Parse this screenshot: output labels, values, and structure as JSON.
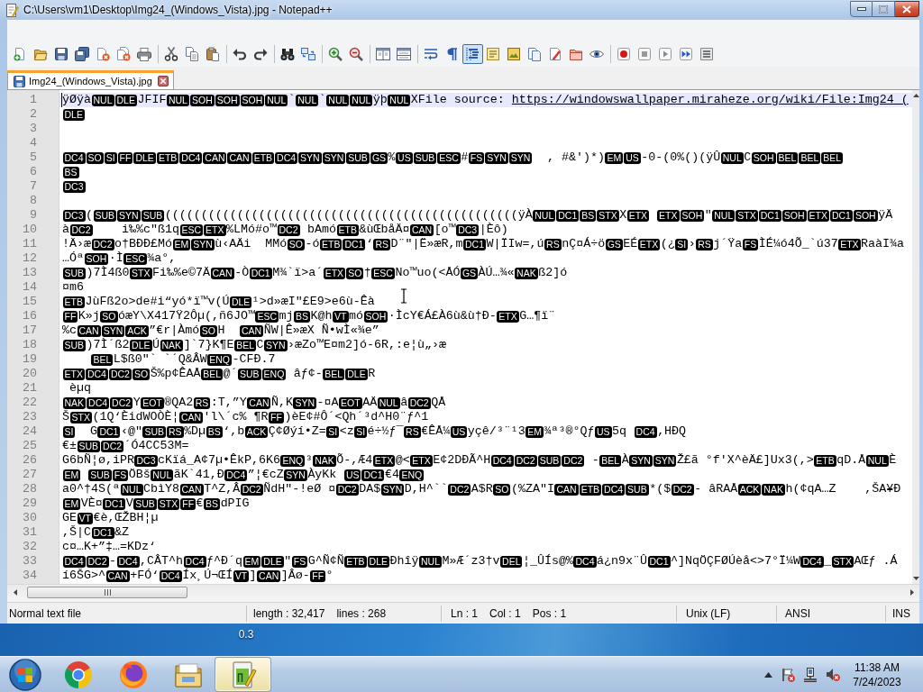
{
  "window": {
    "title": "C:\\Users\\vm1\\Desktop\\Img24_(Windows_Vista).jpg - Notepad++"
  },
  "toolbar": [
    [
      {
        "pressed": false
      },
      {
        "pressed": false
      },
      {
        "pressed": false
      },
      {
        "pressed": false
      },
      {
        "pressed": false
      },
      {
        "pressed": false
      },
      {
        "pressed": false
      }
    ],
    [
      {
        "pressed": false
      },
      {
        "pressed": false
      },
      {
        "pressed": false
      }
    ],
    [
      {
        "pressed": false
      },
      {
        "pressed": false
      }
    ],
    [
      {
        "pressed": false
      },
      {
        "pressed": false
      }
    ],
    [
      {
        "pressed": false
      },
      {
        "pressed": false
      }
    ],
    [
      {
        "pressed": false
      },
      {
        "pressed": false
      }
    ],
    [
      {
        "pressed": false
      },
      {
        "pressed": false
      },
      {
        "pressed": true
      },
      {
        "pressed": false
      },
      {
        "pressed": false
      },
      {
        "pressed": false
      },
      {
        "pressed": false
      },
      {
        "pressed": false
      },
      {
        "pressed": false
      }
    ],
    [
      {
        "pressed": false
      },
      {
        "pressed": false
      },
      {
        "pressed": false
      },
      {
        "pressed": false
      },
      {
        "pressed": false
      }
    ]
  ],
  "tabs": [
    {
      "label": "Img24_(Windows_Vista).jpg",
      "selected": true
    }
  ],
  "editor": {
    "lines": [
      {
        "number": "1",
        "current": true,
        "segments": [
          {
            "kind": "text",
            "text": "ÿØÿà"
          },
          {
            "kind": "control",
            "text": "NUL"
          },
          {
            "kind": "control",
            "text": "DLE"
          },
          {
            "kind": "text",
            "text": "JFIF"
          },
          {
            "kind": "control",
            "text": "NUL"
          },
          {
            "kind": "control",
            "text": "SOH"
          },
          {
            "kind": "control",
            "text": "SOH"
          },
          {
            "kind": "control",
            "text": "SOH"
          },
          {
            "kind": "control",
            "text": "NUL"
          },
          {
            "kind": "text",
            "text": "`"
          },
          {
            "kind": "control",
            "text": "NUL"
          },
          {
            "kind": "text",
            "text": "`"
          },
          {
            "kind": "control",
            "text": "NUL"
          },
          {
            "kind": "control",
            "text": "NUL"
          },
          {
            "kind": "text",
            "text": "ÿþ"
          },
          {
            "kind": "control",
            "text": "NUL"
          },
          {
            "kind": "text",
            "text": "XFile source: "
          },
          {
            "kind": "link",
            "text": "https://windowswallpaper.miraheze.org/wiki/File:Img24_("
          }
        ]
      },
      {
        "number": "2",
        "current": false,
        "segments": [
          {
            "kind": "control",
            "text": "DLE"
          }
        ]
      },
      {
        "number": "3",
        "current": false
      },
      {
        "number": "4",
        "current": false
      },
      {
        "number": "5",
        "current": false,
        "segments": [
          {
            "kind": "control",
            "text": "DC4"
          },
          {
            "kind": "control",
            "text": "SO"
          },
          {
            "kind": "control",
            "text": "SI"
          },
          {
            "kind": "control",
            "text": "FF"
          },
          {
            "kind": "control",
            "text": "DLE"
          },
          {
            "kind": "control",
            "text": "ETB"
          },
          {
            "kind": "control",
            "text": "DC4"
          },
          {
            "kind": "control",
            "text": "CAN"
          },
          {
            "kind": "control",
            "text": "CAN"
          },
          {
            "kind": "control",
            "text": "ETB"
          },
          {
            "kind": "control",
            "text": "DC4"
          },
          {
            "kind": "control",
            "text": "SYN"
          },
          {
            "kind": "control",
            "text": "SYN"
          },
          {
            "kind": "control",
            "text": "SUB"
          },
          {
            "kind": "control",
            "text": "GS"
          },
          {
            "kind": "text",
            "text": "%"
          },
          {
            "kind": "control",
            "text": "US"
          },
          {
            "kind": "control",
            "text": "SUB"
          },
          {
            "kind": "control",
            "text": "ESC"
          },
          {
            "kind": "text",
            "text": "#"
          },
          {
            "kind": "control",
            "text": "FS"
          },
          {
            "kind": "control",
            "text": "SYN"
          },
          {
            "kind": "control",
            "text": "SYN"
          },
          {
            "kind": "text",
            "text": "  , #&')*)"
          },
          {
            "kind": "control",
            "text": "EM"
          },
          {
            "kind": "control",
            "text": "US"
          },
          {
            "kind": "text",
            "text": "-0-(0%()(ÿÛ"
          },
          {
            "kind": "control",
            "text": "NUL"
          },
          {
            "kind": "text",
            "text": "C"
          },
          {
            "kind": "control",
            "text": "SOH"
          },
          {
            "kind": "control",
            "text": "BEL"
          },
          {
            "kind": "control",
            "text": "BEL"
          },
          {
            "kind": "control",
            "text": "BEL"
          }
        ]
      },
      {
        "number": "6",
        "current": false,
        "segments": [
          {
            "kind": "control",
            "text": "BS"
          }
        ]
      },
      {
        "number": "7",
        "current": false,
        "segments": [
          {
            "kind": "control",
            "text": "DC3"
          }
        ]
      },
      {
        "number": "8",
        "current": false
      },
      {
        "number": "9",
        "current": false,
        "segments": [
          {
            "kind": "control",
            "text": "DC3"
          },
          {
            "kind": "text",
            "text": "("
          },
          {
            "kind": "control",
            "text": "SUB"
          },
          {
            "kind": "control",
            "text": "SYN"
          },
          {
            "kind": "control",
            "text": "SUB"
          },
          {
            "kind": "text",
            "text": "(((((((((((((((((((((((((((((((((((((((((((((((((ÿÀ"
          },
          {
            "kind": "control",
            "text": "NUL"
          },
          {
            "kind": "control",
            "text": "DC1"
          },
          {
            "kind": "control",
            "text": "BS"
          },
          {
            "kind": "control",
            "text": "STX"
          },
          {
            "kind": "text",
            "text": "X"
          },
          {
            "kind": "control",
            "text": "ETX"
          },
          {
            "kind": "space"
          },
          {
            "kind": "control",
            "text": "ETX"
          },
          {
            "kind": "control",
            "text": "SOH"
          },
          {
            "kind": "text",
            "text": "\""
          },
          {
            "kind": "control",
            "text": "NUL"
          },
          {
            "kind": "control",
            "text": "STX"
          },
          {
            "kind": "control",
            "text": "DC1"
          },
          {
            "kind": "control",
            "text": "SOH"
          },
          {
            "kind": "control",
            "text": "ETX"
          },
          {
            "kind": "control",
            "text": "DC1"
          },
          {
            "kind": "control",
            "text": "SOH"
          },
          {
            "kind": "text",
            "text": "ÿÄ"
          }
        ]
      },
      {
        "number": "10",
        "current": false,
        "segments": [
          {
            "kind": "text",
            "text": "à"
          },
          {
            "kind": "control",
            "text": "DC2"
          },
          {
            "kind": "text",
            "text": "    i‰%c\"ß1q"
          },
          {
            "kind": "control",
            "text": "ESC"
          },
          {
            "kind": "control",
            "text": "ETX"
          },
          {
            "kind": "text",
            "text": "%LMó#o™"
          },
          {
            "kind": "control",
            "text": "DC2"
          },
          {
            "kind": "text",
            "text": " bAmó"
          },
          {
            "kind": "control",
            "text": "ETB"
          },
          {
            "kind": "text",
            "text": "&ùŒbåÄ¤"
          },
          {
            "kind": "control",
            "text": "CAN"
          },
          {
            "kind": "text",
            "text": "[o™"
          },
          {
            "kind": "control",
            "text": "DC3"
          },
          {
            "kind": "text",
            "text": "|Èô)"
          }
        ]
      },
      {
        "number": "11",
        "current": false,
        "segments": [
          {
            "kind": "text",
            "text": "!Ä›æ"
          },
          {
            "kind": "control",
            "text": "DC2"
          },
          {
            "kind": "text",
            "text": "o†BÐÐ£Mó"
          },
          {
            "kind": "control",
            "text": "EM"
          },
          {
            "kind": "control",
            "text": "SYN"
          },
          {
            "kind": "text",
            "text": "ù‹AÄi  MMó"
          },
          {
            "kind": "control",
            "text": "SO"
          },
          {
            "kind": "text",
            "text": "-ó"
          },
          {
            "kind": "control",
            "text": "ETB"
          },
          {
            "kind": "control",
            "text": "DC1"
          },
          {
            "kind": "text",
            "text": "‘"
          },
          {
            "kind": "control",
            "text": "RS"
          },
          {
            "kind": "text",
            "text": "D¨\"|Ë»æR,m"
          },
          {
            "kind": "control",
            "text": "DC1"
          },
          {
            "kind": "text",
            "text": "W|ÏIw=,ú"
          },
          {
            "kind": "control",
            "text": "RS"
          },
          {
            "kind": "text",
            "text": "nÇ¤Á÷ö"
          },
          {
            "kind": "control",
            "text": "GS"
          },
          {
            "kind": "text",
            "text": "EÉ"
          },
          {
            "kind": "control",
            "text": "ETX"
          },
          {
            "kind": "text",
            "text": "(¿"
          },
          {
            "kind": "control",
            "text": "SI"
          },
          {
            "kind": "text",
            "text": "›"
          },
          {
            "kind": "control",
            "text": "RS"
          },
          {
            "kind": "text",
            "text": "j´Ÿa"
          },
          {
            "kind": "control",
            "text": "FS"
          },
          {
            "kind": "text",
            "text": "ÌÉ¼ó4Õ_`ú37"
          },
          {
            "kind": "control",
            "text": "ETX"
          },
          {
            "kind": "text",
            "text": "RaàI¾a"
          }
        ]
      },
      {
        "number": "12",
        "current": false,
        "segments": [
          {
            "kind": "text",
            "text": "…Óª"
          },
          {
            "kind": "control",
            "text": "SOH"
          },
          {
            "kind": "text",
            "text": "·Ì"
          },
          {
            "kind": "control",
            "text": "ESC"
          },
          {
            "kind": "text",
            "text": "¾a°,"
          }
        ]
      },
      {
        "number": "13",
        "current": false,
        "segments": [
          {
            "kind": "control",
            "text": "SUB"
          },
          {
            "kind": "text",
            "text": ")7Ì4ß0"
          },
          {
            "kind": "control",
            "text": "STX"
          },
          {
            "kind": "text",
            "text": "Fi‰%e©7Ä"
          },
          {
            "kind": "control",
            "text": "CAN"
          },
          {
            "kind": "text",
            "text": "-Ò"
          },
          {
            "kind": "control",
            "text": "DC1"
          },
          {
            "kind": "text",
            "text": "M¾`ï>a´"
          },
          {
            "kind": "control",
            "text": "ETX"
          },
          {
            "kind": "control",
            "text": "SO"
          },
          {
            "kind": "text",
            "text": "†"
          },
          {
            "kind": "control",
            "text": "ESC"
          },
          {
            "kind": "text",
            "text": "No™uo(<ÅÓ"
          },
          {
            "kind": "control",
            "text": "GS"
          },
          {
            "kind": "text",
            "text": "ÀÚ…¾«"
          },
          {
            "kind": "control",
            "text": "NAK"
          },
          {
            "kind": "text",
            "text": "ß2]ó"
          }
        ]
      },
      {
        "number": "14",
        "current": false,
        "segments": [
          {
            "kind": "text",
            "text": "¤m6"
          }
        ]
      },
      {
        "number": "15",
        "current": false,
        "segments": [
          {
            "kind": "control",
            "text": "ETB"
          },
          {
            "kind": "text",
            "text": "JùFß2o>de#i“yó*ï™v(Ú"
          },
          {
            "kind": "control",
            "text": "DLE"
          },
          {
            "kind": "text",
            "text": "¹>d»æI\"£E9>e6ù-Êà"
          }
        ]
      },
      {
        "number": "16",
        "current": false,
        "segments": [
          {
            "kind": "control",
            "text": "FF"
          },
          {
            "kind": "text",
            "text": "K»j"
          },
          {
            "kind": "control",
            "text": "SO"
          },
          {
            "kind": "text",
            "text": "óæY\\X417Ÿ2Ôµ(,ñ6JO™"
          },
          {
            "kind": "control",
            "text": "ESC"
          },
          {
            "kind": "text",
            "text": "mj"
          },
          {
            "kind": "control",
            "text": "BS"
          },
          {
            "kind": "text",
            "text": "K@h"
          },
          {
            "kind": "control",
            "text": "VT"
          },
          {
            "kind": "text",
            "text": "mó"
          },
          {
            "kind": "control",
            "text": "SOH"
          },
          {
            "kind": "text",
            "text": "·ÌcY€Á£À6ù&ù†Ð-"
          },
          {
            "kind": "control",
            "text": "ETX"
          },
          {
            "kind": "text",
            "text": "G…¶ï¨"
          }
        ]
      },
      {
        "number": "17",
        "current": false,
        "segments": [
          {
            "kind": "text",
            "text": "%c"
          },
          {
            "kind": "control",
            "text": "CAN"
          },
          {
            "kind": "control",
            "text": "SYN"
          },
          {
            "kind": "control",
            "text": "ACK"
          },
          {
            "kind": "text",
            "text": "”€r|Àmó"
          },
          {
            "kind": "control",
            "text": "SO"
          },
          {
            "kind": "text",
            "text": "H  "
          },
          {
            "kind": "control",
            "text": "CAN"
          },
          {
            "kind": "text",
            "text": "ÑW|Ê»æX Ñ•wÌ«¾e”"
          }
        ]
      },
      {
        "number": "18",
        "current": false,
        "segments": [
          {
            "kind": "control",
            "text": "SUB"
          },
          {
            "kind": "text",
            "text": ")7Ì´ß2"
          },
          {
            "kind": "control",
            "text": "DLE"
          },
          {
            "kind": "text",
            "text": "Ú"
          },
          {
            "kind": "control",
            "text": "NAK"
          },
          {
            "kind": "text",
            "text": "]`7}K¶E"
          },
          {
            "kind": "control",
            "text": "BEL"
          },
          {
            "kind": "text",
            "text": "C"
          },
          {
            "kind": "control",
            "text": "SYN"
          },
          {
            "kind": "text",
            "text": "›æZo™E¤m2]ó-6R,:e¦ù„›æ"
          }
        ]
      },
      {
        "number": "19",
        "current": false,
        "segments": [
          {
            "kind": "space"
          },
          {
            "kind": "space"
          },
          {
            "kind": "space"
          },
          {
            "kind": "space"
          },
          {
            "kind": "control",
            "text": "BEL"
          },
          {
            "kind": "text",
            "text": "L$ß0\"` `´Q&ÂW"
          },
          {
            "kind": "control",
            "text": "ENQ"
          },
          {
            "kind": "text",
            "text": "-CFÐ.7"
          }
        ]
      },
      {
        "number": "20",
        "current": false,
        "segments": [
          {
            "kind": "control",
            "text": "ETX"
          },
          {
            "kind": "control",
            "text": "DC4"
          },
          {
            "kind": "control",
            "text": "DC2"
          },
          {
            "kind": "control",
            "text": "SO"
          },
          {
            "kind": "text",
            "text": "Š%p¢ÊAÅ"
          },
          {
            "kind": "control",
            "text": "BEL"
          },
          {
            "kind": "text",
            "text": "@´"
          },
          {
            "kind": "control",
            "text": "SUB"
          },
          {
            "kind": "control",
            "text": "ENQ"
          },
          {
            "kind": "text",
            "text": " âƒ¢-"
          },
          {
            "kind": "control",
            "text": "BEL"
          },
          {
            "kind": "control",
            "text": "DLE"
          },
          {
            "kind": "text",
            "text": "R"
          }
        ]
      },
      {
        "number": "21",
        "current": false,
        "segments": [
          {
            "kind": "text",
            "text": " èµq"
          }
        ]
      },
      {
        "number": "22",
        "current": false,
        "segments": [
          {
            "kind": "control",
            "text": "NAK"
          },
          {
            "kind": "control",
            "text": "DC4"
          },
          {
            "kind": "control",
            "text": "DC2"
          },
          {
            "kind": "text",
            "text": "Y"
          },
          {
            "kind": "control",
            "text": "EOT"
          },
          {
            "kind": "text",
            "text": "®QA2"
          },
          {
            "kind": "control",
            "text": "RS"
          },
          {
            "kind": "text",
            "text": ":T,”Y"
          },
          {
            "kind": "control",
            "text": "CAN"
          },
          {
            "kind": "text",
            "text": "Ñ,K"
          },
          {
            "kind": "control",
            "text": "SYN"
          },
          {
            "kind": "text",
            "text": "-¤A"
          },
          {
            "kind": "control",
            "text": "EOT"
          },
          {
            "kind": "text",
            "text": "AÄ"
          },
          {
            "kind": "control",
            "text": "NUL"
          },
          {
            "kind": "text",
            "text": "â"
          },
          {
            "kind": "control",
            "text": "DC2"
          },
          {
            "kind": "text",
            "text": "QÅ"
          }
        ]
      },
      {
        "number": "23",
        "current": false,
        "segments": [
          {
            "kind": "text",
            "text": "Š"
          },
          {
            "kind": "control",
            "text": "STX"
          },
          {
            "kind": "text",
            "text": "(1Q‘ÈidWOÒÈ¦"
          },
          {
            "kind": "control",
            "text": "CAN"
          },
          {
            "kind": "text",
            "text": "'l\\´c% ¶R"
          },
          {
            "kind": "control",
            "text": "FF"
          },
          {
            "kind": "text",
            "text": ")èE¢#Ô´<Qh´³d^H0¨ƒ^1"
          }
        ]
      },
      {
        "number": "24",
        "current": false,
        "segments": [
          {
            "kind": "control",
            "text": "SI"
          },
          {
            "kind": "text",
            "text": "  G"
          },
          {
            "kind": "control",
            "text": "DC1"
          },
          {
            "kind": "text",
            "text": "‹@\""
          },
          {
            "kind": "control",
            "text": "SUB"
          },
          {
            "kind": "control",
            "text": "RS"
          },
          {
            "kind": "text",
            "text": "%Dµ"
          },
          {
            "kind": "control",
            "text": "BS"
          },
          {
            "kind": "text",
            "text": "‘,b"
          },
          {
            "kind": "control",
            "text": "ACK"
          },
          {
            "kind": "text",
            "text": "Ç¢Øýí•Z="
          },
          {
            "kind": "control",
            "text": "SI"
          },
          {
            "kind": "text",
            "text": "<z"
          },
          {
            "kind": "control",
            "text": "SI"
          },
          {
            "kind": "text",
            "text": "é÷½ƒ¯"
          },
          {
            "kind": "control",
            "text": "RS"
          },
          {
            "kind": "text",
            "text": "€ÊÅ¼"
          },
          {
            "kind": "control",
            "text": "US"
          },
          {
            "kind": "text",
            "text": "yçê/³¨¹3"
          },
          {
            "kind": "control",
            "text": "EM"
          },
          {
            "kind": "text",
            "text": "¾ª³®°Qƒ"
          },
          {
            "kind": "control",
            "text": "US"
          },
          {
            "kind": "text",
            "text": "5q "
          },
          {
            "kind": "control",
            "text": "DC4"
          },
          {
            "kind": "text",
            "text": ",HÐQ"
          }
        ]
      },
      {
        "number": "25",
        "current": false,
        "segments": [
          {
            "kind": "text",
            "text": "€±"
          },
          {
            "kind": "control",
            "text": "SUB"
          },
          {
            "kind": "control",
            "text": "DC2"
          },
          {
            "kind": "text",
            "text": "´Ó4CC53M="
          }
        ]
      },
      {
        "number": "26",
        "current": false,
        "segments": [
          {
            "kind": "text",
            "text": "G6bÑ¦ø,iPR"
          },
          {
            "kind": "control",
            "text": "DC3"
          },
          {
            "kind": "text",
            "text": "cKïá_A¢7µ•ÊkP,6K6"
          },
          {
            "kind": "control",
            "text": "ENQ"
          },
          {
            "kind": "text",
            "text": "³"
          },
          {
            "kind": "control",
            "text": "NAK"
          },
          {
            "kind": "text",
            "text": "Õ-,Æ4"
          },
          {
            "kind": "control",
            "text": "ETX"
          },
          {
            "kind": "text",
            "text": "@<"
          },
          {
            "kind": "control",
            "text": "ETX"
          },
          {
            "kind": "text",
            "text": "E¢2DÐÃ^H"
          },
          {
            "kind": "control",
            "text": "DC4"
          },
          {
            "kind": "control",
            "text": "DC2"
          },
          {
            "kind": "control",
            "text": "SUB"
          },
          {
            "kind": "control",
            "text": "DC2"
          },
          {
            "kind": "text",
            "text": " -"
          },
          {
            "kind": "control",
            "text": "BEL"
          },
          {
            "kind": "text",
            "text": "À"
          },
          {
            "kind": "control",
            "text": "SYN"
          },
          {
            "kind": "control",
            "text": "SYN"
          },
          {
            "kind": "text",
            "text": "Ž£ã °f'X^èÄ£]Ux3(,>"
          },
          {
            "kind": "control",
            "text": "ETB"
          },
          {
            "kind": "text",
            "text": "qD.Å"
          },
          {
            "kind": "control",
            "text": "NUL"
          },
          {
            "kind": "text",
            "text": "È"
          }
        ]
      },
      {
        "number": "27",
        "current": false,
        "segments": [
          {
            "kind": "control",
            "text": "EM"
          },
          {
            "kind": "space"
          },
          {
            "kind": "control",
            "text": "SUB"
          },
          {
            "kind": "control",
            "text": "FS"
          },
          {
            "kind": "text",
            "text": "ÖBš"
          },
          {
            "kind": "control",
            "text": "NUL"
          },
          {
            "kind": "text",
            "text": "ãK`41,Ð"
          },
          {
            "kind": "control",
            "text": "DC4"
          },
          {
            "kind": "text",
            "text": "”¦€cZ"
          },
          {
            "kind": "control",
            "text": "SYN"
          },
          {
            "kind": "text",
            "text": "ÀyKk "
          },
          {
            "kind": "control",
            "text": "US"
          },
          {
            "kind": "control",
            "text": "DC1"
          },
          {
            "kind": "text",
            "text": "€4"
          },
          {
            "kind": "control",
            "text": "ENQ"
          }
        ]
      },
      {
        "number": "28",
        "current": false,
        "segments": [
          {
            "kind": "text",
            "text": "a0^†4S(ª"
          },
          {
            "kind": "control",
            "text": "NUL"
          },
          {
            "kind": "text",
            "text": "CbìY8"
          },
          {
            "kind": "control",
            "text": "CAN"
          },
          {
            "kind": "text",
            "text": "T^Z,Â"
          },
          {
            "kind": "control",
            "text": "DC2"
          },
          {
            "kind": "text",
            "text": "ÑdH\"-!eØ ¤"
          },
          {
            "kind": "control",
            "text": "DC2"
          },
          {
            "kind": "text",
            "text": "DA$"
          },
          {
            "kind": "control",
            "text": "SYN"
          },
          {
            "kind": "text",
            "text": "D,H^``"
          },
          {
            "kind": "control",
            "text": "DC2"
          },
          {
            "kind": "text",
            "text": "A$R"
          },
          {
            "kind": "control",
            "text": "SO"
          },
          {
            "kind": "text",
            "text": "(%ZA\"I"
          },
          {
            "kind": "control",
            "text": "CAN"
          },
          {
            "kind": "control",
            "text": "ETB"
          },
          {
            "kind": "control",
            "text": "DC4"
          },
          {
            "kind": "control",
            "text": "SUB"
          },
          {
            "kind": "text",
            "text": "*($"
          },
          {
            "kind": "control",
            "text": "DC2"
          },
          {
            "kind": "text",
            "text": "- âRAÅ"
          },
          {
            "kind": "control",
            "text": "ACK"
          },
          {
            "kind": "control",
            "text": "NAK"
          },
          {
            "kind": "text",
            "text": "h(¢qA…Z    ,ŠA¥Ð"
          }
        ]
      },
      {
        "number": "29",
        "current": false,
        "segments": [
          {
            "kind": "control",
            "text": "EM"
          },
          {
            "kind": "text",
            "text": "VÈ¤"
          },
          {
            "kind": "control",
            "text": "DC1"
          },
          {
            "kind": "text",
            "text": "V"
          },
          {
            "kind": "control",
            "text": "SUB"
          },
          {
            "kind": "control",
            "text": "STX"
          },
          {
            "kind": "control",
            "text": "FF"
          },
          {
            "kind": "text",
            "text": "€"
          },
          {
            "kind": "control",
            "text": "BS"
          },
          {
            "kind": "text",
            "text": "dPIG"
          }
        ]
      },
      {
        "number": "30",
        "current": false,
        "segments": [
          {
            "kind": "text",
            "text": "GE"
          },
          {
            "kind": "control",
            "text": "VT"
          },
          {
            "kind": "text",
            "text": "€è,ŒŽBH¦µ"
          }
        ]
      },
      {
        "number": "31",
        "current": false,
        "segments": [
          {
            "kind": "text",
            "text": ",Š|C"
          },
          {
            "kind": "control",
            "text": "DC1"
          },
          {
            "kind": "text",
            "text": "&Z"
          }
        ]
      },
      {
        "number": "32",
        "current": false,
        "segments": [
          {
            "kind": "text",
            "text": "c¤…K+”‡…=KDz‘"
          }
        ]
      },
      {
        "number": "33",
        "current": false,
        "segments": [
          {
            "kind": "control",
            "text": "DC4"
          },
          {
            "kind": "control",
            "text": "DC2"
          },
          {
            "kind": "text",
            "text": "-"
          },
          {
            "kind": "control",
            "text": "DC4"
          },
          {
            "kind": "text",
            "text": ",CÂT^h"
          },
          {
            "kind": "control",
            "text": "DC4"
          },
          {
            "kind": "text",
            "text": "ƒ^Ð´q"
          },
          {
            "kind": "control",
            "text": "EM"
          },
          {
            "kind": "control",
            "text": "DLE"
          },
          {
            "kind": "text",
            "text": "\""
          },
          {
            "kind": "control",
            "text": "FS"
          },
          {
            "kind": "text",
            "text": "G^Ñ¢Ñ"
          },
          {
            "kind": "control",
            "text": "ETB"
          },
          {
            "kind": "control",
            "text": "DLE"
          },
          {
            "kind": "text",
            "text": "Ðhîÿ"
          },
          {
            "kind": "control",
            "text": "NUL"
          },
          {
            "kind": "text",
            "text": "M»Æ´z3†v"
          },
          {
            "kind": "control",
            "text": "DEL"
          },
          {
            "kind": "text",
            "text": "¦_ÛÍs@%"
          },
          {
            "kind": "control",
            "text": "DC4"
          },
          {
            "kind": "text",
            "text": "á¿n9x¨Û"
          },
          {
            "kind": "control",
            "text": "DC1"
          },
          {
            "kind": "text",
            "text": "^]NqÖÇFØÚèå<>7°Ï¼W"
          },
          {
            "kind": "control",
            "text": "DC4"
          },
          {
            "kind": "text",
            "text": "_"
          },
          {
            "kind": "control",
            "text": "STX"
          },
          {
            "kind": "text",
            "text": "AŒƒ .Á"
          }
        ]
      },
      {
        "number": "34",
        "current": false,
        "segments": [
          {
            "kind": "text",
            "text": "í6ŠG>^"
          },
          {
            "kind": "control",
            "text": "CAN"
          },
          {
            "kind": "text",
            "text": "+FÓ‘"
          },
          {
            "kind": "control",
            "text": "DC4"
          },
          {
            "kind": "text",
            "text": "Íx¸Ú¬ŒÍ"
          },
          {
            "kind": "control",
            "text": "VT"
          },
          {
            "kind": "text",
            "text": "]"
          },
          {
            "kind": "control",
            "text": "CAN"
          },
          {
            "kind": "text",
            "text": "]Âø-"
          },
          {
            "kind": "control",
            "text": "FF"
          },
          {
            "kind": "text",
            "text": "°"
          }
        ]
      }
    ]
  },
  "status_bar": [
    {
      "texts": [
        "Normal text file"
      ]
    },
    {
      "texts": [
        "length : 32,417",
        "lines : 268"
      ]
    },
    {
      "texts": [
        "Ln : 1",
        "Col : 1",
        "Pos : 1"
      ]
    },
    {
      "texts": [
        "Unix (LF)"
      ]
    },
    {
      "texts": [
        "ANSI"
      ]
    },
    {
      "texts": [
        "INS"
      ]
    }
  ],
  "desktop": {
    "icon_labels": [
      "0.3"
    ]
  },
  "taskbar": {
    "apps": [
      {
        "selected": false
      },
      {
        "selected": false
      },
      {
        "selected": false
      },
      {
        "selected": true
      }
    ],
    "clock": {
      "time": "11:38 AM",
      "date": "7/24/2023"
    }
  }
}
